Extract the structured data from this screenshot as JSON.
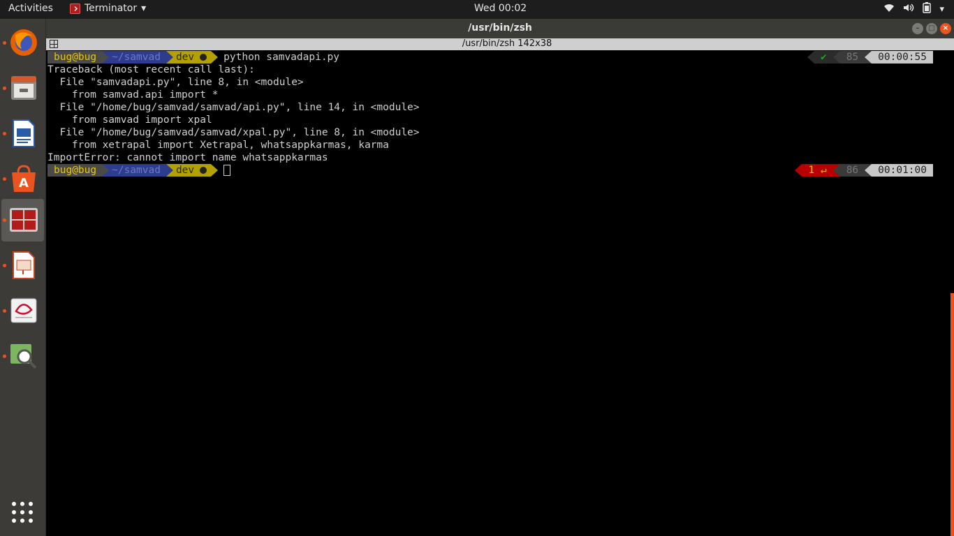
{
  "topbar": {
    "activities": "Activities",
    "app_name": "Terminator",
    "app_dropdown": "▾",
    "clock": "Wed 00:02",
    "tray": {
      "wifi_icon": "wifi-icon",
      "volume_icon": "volume-icon",
      "battery_icon": "battery-icon",
      "menu_arrow": "▾"
    }
  },
  "dock": {
    "items": [
      {
        "name": "firefox",
        "icon": "firefox-icon",
        "running": true
      },
      {
        "name": "files",
        "icon": "files-icon",
        "running": true
      },
      {
        "name": "writer",
        "icon": "writer-icon",
        "running": true
      },
      {
        "name": "software",
        "icon": "software-icon",
        "running": true
      },
      {
        "name": "terminator",
        "icon": "terminator-icon",
        "running": true,
        "active": true
      },
      {
        "name": "impress",
        "icon": "impress-icon",
        "running": true
      },
      {
        "name": "evince",
        "icon": "evince-icon",
        "running": true
      },
      {
        "name": "system-monitor",
        "icon": "system-monitor-icon",
        "running": true
      }
    ],
    "show_apps_icon": "apps-grid-icon"
  },
  "window": {
    "title": "/usr/bin/zsh",
    "terminal_title": "/usr/bin/zsh 142x38",
    "buttons": {
      "minimize": "–",
      "maximize": "□",
      "close": "×"
    }
  },
  "terminal": {
    "prompt1": {
      "user": "bug@bug",
      "dir": "~/samvad",
      "branch_icon": "",
      "branch": "dev",
      "command": "python samvadapi.py"
    },
    "rprompt1": {
      "status": "✔",
      "history": "85",
      "time": "00:00:55"
    },
    "output": [
      "Traceback (most recent call last):",
      "  File \"samvadapi.py\", line 8, in <module>",
      "    from samvad.api import *",
      "  File \"/home/bug/samvad/samvad/api.py\", line 14, in <module>",
      "    from samvad import xpal",
      "  File \"/home/bug/samvad/samvad/xpal.py\", line 8, in <module>",
      "    from xetrapal import Xetrapal, whatsappkarmas, karma",
      "ImportError: cannot import name whatsappkarmas"
    ],
    "prompt2": {
      "user": "bug@bug",
      "dir": "~/samvad",
      "branch_icon": "",
      "branch": "dev"
    },
    "rprompt2": {
      "status": "1 ↵",
      "history": "86",
      "time": "00:01:00"
    }
  },
  "colors": {
    "accent": "#e95420",
    "dock_bg": "#3c3b37",
    "topbar_bg": "#1d1d1d"
  }
}
